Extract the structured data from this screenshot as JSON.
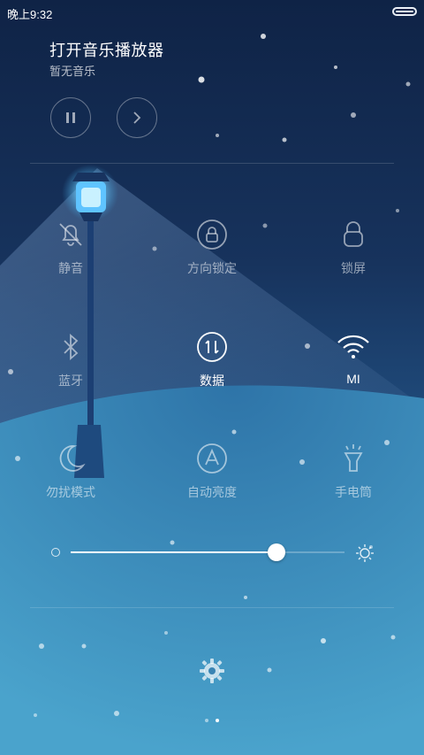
{
  "status": {
    "time": "晚上9:32"
  },
  "music": {
    "title": "打开音乐播放器",
    "subtitle": "暂无音乐"
  },
  "media_controls": [
    {
      "name": "pause-button",
      "icon": "pause-icon"
    },
    {
      "name": "next-button",
      "icon": "chevron-right-icon"
    }
  ],
  "tiles": [
    {
      "id": "silent",
      "label": "静音",
      "icon": "bell-off-icon",
      "active": false
    },
    {
      "id": "rotation-lock",
      "label": "方向锁定",
      "icon": "rotation-lock-icon",
      "active": false
    },
    {
      "id": "lock-screen",
      "label": "锁屏",
      "icon": "lock-icon",
      "active": false
    },
    {
      "id": "bluetooth",
      "label": "蓝牙",
      "icon": "bluetooth-icon",
      "active": false
    },
    {
      "id": "data",
      "label": "数据",
      "icon": "data-arrows-icon",
      "active": true
    },
    {
      "id": "wifi",
      "label": "MI",
      "icon": "wifi-icon",
      "active": true
    },
    {
      "id": "dnd",
      "label": "勿扰模式",
      "icon": "moon-icon",
      "active": false
    },
    {
      "id": "auto-brightness",
      "label": "自动亮度",
      "icon": "auto-brightness-icon",
      "active": false
    },
    {
      "id": "flashlight",
      "label": "手电筒",
      "icon": "flashlight-icon",
      "active": false
    }
  ],
  "brightness": {
    "value_fraction": 0.75
  },
  "colors": {
    "accent_white": "#ffffff",
    "dim_white": "rgba(255,255,255,0.55)"
  }
}
